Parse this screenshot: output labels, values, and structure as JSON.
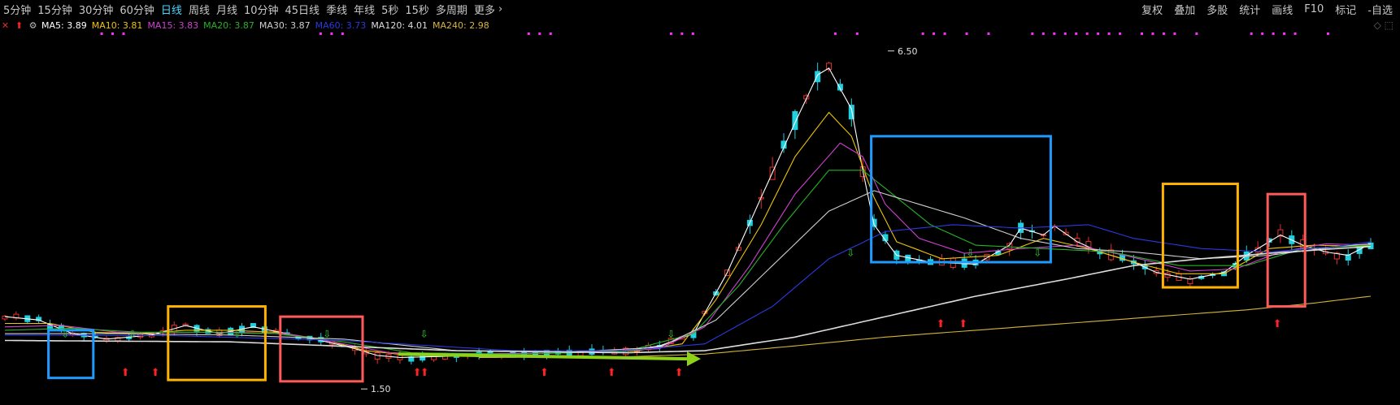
{
  "toolbar": {
    "periods": [
      "5分钟",
      "15分钟",
      "30分钟",
      "60分钟",
      "日线",
      "周线",
      "月线",
      "10分钟",
      "45日线",
      "季线",
      "年线",
      "5秒",
      "15秒",
      "多周期",
      "更多"
    ],
    "active_period": "日线",
    "more_chevron": "›",
    "right_tools": [
      "复权",
      "叠加",
      "多股",
      "统计",
      "画线",
      "F10",
      "标记",
      "-自选"
    ]
  },
  "ma_legend": [
    {
      "label": "MA5:",
      "value": "3.89",
      "color": "#ffffff"
    },
    {
      "label": "MA10:",
      "value": "3.81",
      "color": "#f0c400"
    },
    {
      "label": "MA15:",
      "value": "3.83",
      "color": "#d040d0"
    },
    {
      "label": "MA20:",
      "value": "3.87",
      "color": "#26b326"
    },
    {
      "label": "MA30:",
      "value": "3.87",
      "color": "#cfcfcf"
    },
    {
      "label": "MA60:",
      "value": "3.73",
      "color": "#2a3ae0"
    },
    {
      "label": "MA120:",
      "value": "4.01",
      "color": "#dddddd"
    },
    {
      "label": "MA240:",
      "value": "2.98",
      "color": "#d8b43a"
    }
  ],
  "icons": {
    "close": "close-icon",
    "up_arrow": "red-up-arrow-icon",
    "settings": "settings-icon"
  },
  "colors": {
    "up": "#e0312a",
    "down": "#1fd0e0",
    "buy_arrow": "#ff2222",
    "sell_arrow": "#33cc33",
    "signal_dot": "#ff2bff"
  },
  "chart_data": {
    "type": "candlestick",
    "title": "",
    "price_range": [
      1.3,
      6.7
    ],
    "annotations": [
      {
        "text": "6.50",
        "kind": "high"
      },
      {
        "text": "1.50",
        "kind": "low"
      }
    ],
    "highlight_boxes": [
      "blue",
      "orange",
      "red",
      "blue",
      "orange",
      "red"
    ],
    "trend_arrow_color": "#8fd11a",
    "series_points": {
      "MA5": [
        [
          0,
          2.55
        ],
        [
          3,
          2.5
        ],
        [
          6,
          2.3
        ],
        [
          9,
          2.22
        ],
        [
          13,
          2.28
        ],
        [
          16,
          2.42
        ],
        [
          19,
          2.3
        ],
        [
          22,
          2.4
        ],
        [
          25,
          2.3
        ],
        [
          28,
          2.2
        ],
        [
          31,
          2.08
        ],
        [
          33,
          1.98
        ],
        [
          35,
          1.95
        ],
        [
          40,
          1.97
        ],
        [
          45,
          2.0
        ],
        [
          50,
          2.02
        ],
        [
          55,
          2.05
        ],
        [
          58,
          2.12
        ],
        [
          61,
          2.3
        ],
        [
          64,
          3.2
        ],
        [
          67,
          4.3
        ],
        [
          70,
          5.4
        ],
        [
          72,
          6.1
        ],
        [
          73,
          6.2
        ],
        [
          75,
          5.6
        ],
        [
          76,
          4.7
        ],
        [
          77,
          3.9
        ],
        [
          79,
          3.45
        ],
        [
          82,
          3.35
        ],
        [
          86,
          3.32
        ],
        [
          89,
          3.6
        ],
        [
          90,
          3.85
        ],
        [
          92,
          3.75
        ],
        [
          93,
          3.88
        ],
        [
          95,
          3.65
        ],
        [
          97,
          3.5
        ],
        [
          100,
          3.35
        ],
        [
          102,
          3.2
        ],
        [
          105,
          3.1
        ],
        [
          108,
          3.2
        ],
        [
          110,
          3.45
        ],
        [
          113,
          3.75
        ],
        [
          115,
          3.6
        ],
        [
          117,
          3.5
        ],
        [
          119,
          3.45
        ],
        [
          121,
          3.62
        ]
      ],
      "MA10": [
        [
          0,
          2.45
        ],
        [
          4,
          2.45
        ],
        [
          8,
          2.32
        ],
        [
          12,
          2.3
        ],
        [
          16,
          2.35
        ],
        [
          20,
          2.35
        ],
        [
          24,
          2.32
        ],
        [
          28,
          2.22
        ],
        [
          32,
          2.05
        ],
        [
          36,
          1.98
        ],
        [
          44,
          2.0
        ],
        [
          50,
          2.02
        ],
        [
          56,
          2.05
        ],
        [
          60,
          2.15
        ],
        [
          63,
          2.8
        ],
        [
          67,
          3.9
        ],
        [
          70,
          4.9
        ],
        [
          73,
          5.55
        ],
        [
          75,
          5.2
        ],
        [
          77,
          4.3
        ],
        [
          79,
          3.65
        ],
        [
          83,
          3.4
        ],
        [
          88,
          3.45
        ],
        [
          92,
          3.7
        ],
        [
          96,
          3.55
        ],
        [
          100,
          3.35
        ],
        [
          104,
          3.18
        ],
        [
          108,
          3.18
        ],
        [
          112,
          3.55
        ],
        [
          116,
          3.6
        ],
        [
          121,
          3.58
        ]
      ],
      "MA15": [
        [
          0,
          2.4
        ],
        [
          5,
          2.42
        ],
        [
          10,
          2.32
        ],
        [
          15,
          2.32
        ],
        [
          20,
          2.32
        ],
        [
          25,
          2.3
        ],
        [
          30,
          2.15
        ],
        [
          34,
          2.02
        ],
        [
          40,
          2.0
        ],
        [
          50,
          2.02
        ],
        [
          58,
          2.08
        ],
        [
          62,
          2.4
        ],
        [
          66,
          3.3
        ],
        [
          70,
          4.35
        ],
        [
          74,
          5.1
        ],
        [
          76,
          4.9
        ],
        [
          78,
          4.2
        ],
        [
          81,
          3.7
        ],
        [
          85,
          3.48
        ],
        [
          90,
          3.55
        ],
        [
          95,
          3.6
        ],
        [
          100,
          3.42
        ],
        [
          105,
          3.22
        ],
        [
          109,
          3.25
        ],
        [
          113,
          3.5
        ],
        [
          117,
          3.62
        ],
        [
          121,
          3.6
        ]
      ],
      "MA20": [
        [
          0,
          2.35
        ],
        [
          6,
          2.38
        ],
        [
          12,
          2.32
        ],
        [
          18,
          2.32
        ],
        [
          24,
          2.3
        ],
        [
          30,
          2.18
        ],
        [
          36,
          2.02
        ],
        [
          45,
          2.0
        ],
        [
          55,
          2.04
        ],
        [
          61,
          2.3
        ],
        [
          65,
          3.0
        ],
        [
          69,
          3.9
        ],
        [
          73,
          4.7
        ],
        [
          76,
          4.7
        ],
        [
          79,
          4.3
        ],
        [
          82,
          3.9
        ],
        [
          86,
          3.6
        ],
        [
          92,
          3.55
        ],
        [
          98,
          3.5
        ],
        [
          104,
          3.3
        ],
        [
          110,
          3.3
        ],
        [
          115,
          3.55
        ],
        [
          121,
          3.6
        ]
      ],
      "MA30": [
        [
          0,
          2.3
        ],
        [
          10,
          2.3
        ],
        [
          20,
          2.28
        ],
        [
          30,
          2.22
        ],
        [
          40,
          2.05
        ],
        [
          50,
          2.03
        ],
        [
          58,
          2.1
        ],
        [
          63,
          2.5
        ],
        [
          68,
          3.3
        ],
        [
          73,
          4.1
        ],
        [
          77,
          4.4
        ],
        [
          81,
          4.2
        ],
        [
          85,
          4.0
        ],
        [
          90,
          3.7
        ],
        [
          95,
          3.55
        ],
        [
          100,
          3.5
        ],
        [
          106,
          3.4
        ],
        [
          112,
          3.45
        ],
        [
          118,
          3.58
        ],
        [
          121,
          3.62
        ]
      ],
      "MA60": [
        [
          0,
          2.28
        ],
        [
          15,
          2.27
        ],
        [
          30,
          2.2
        ],
        [
          45,
          2.05
        ],
        [
          55,
          2.05
        ],
        [
          62,
          2.15
        ],
        [
          68,
          2.7
        ],
        [
          73,
          3.4
        ],
        [
          78,
          3.8
        ],
        [
          84,
          3.9
        ],
        [
          90,
          3.85
        ],
        [
          96,
          3.9
        ],
        [
          100,
          3.7
        ],
        [
          106,
          3.55
        ],
        [
          112,
          3.5
        ],
        [
          118,
          3.58
        ],
        [
          121,
          3.65
        ]
      ],
      "MA120": [
        [
          0,
          2.2
        ],
        [
          20,
          2.18
        ],
        [
          40,
          2.05
        ],
        [
          55,
          2.02
        ],
        [
          62,
          2.05
        ],
        [
          70,
          2.25
        ],
        [
          78,
          2.55
        ],
        [
          86,
          2.85
        ],
        [
          94,
          3.1
        ],
        [
          100,
          3.3
        ],
        [
          106,
          3.4
        ],
        [
          112,
          3.48
        ],
        [
          118,
          3.55
        ],
        [
          121,
          3.58
        ]
      ],
      "MA240": [
        [
          42,
          1.95
        ],
        [
          55,
          1.96
        ],
        [
          62,
          2.0
        ],
        [
          70,
          2.12
        ],
        [
          78,
          2.25
        ],
        [
          86,
          2.35
        ],
        [
          94,
          2.45
        ],
        [
          102,
          2.55
        ],
        [
          110,
          2.65
        ],
        [
          116,
          2.75
        ],
        [
          121,
          2.85
        ]
      ]
    }
  }
}
